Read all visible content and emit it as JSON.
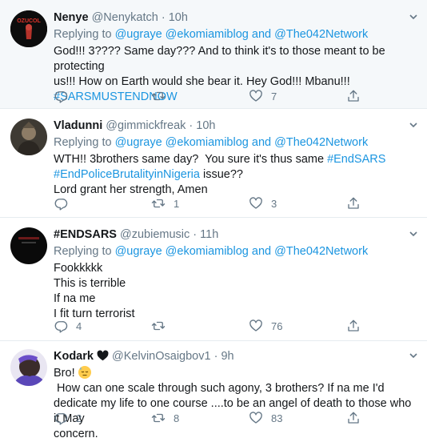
{
  "tweets": [
    {
      "display_name": "Nenye",
      "handle": "@Nenykatch",
      "dot": "·",
      "time": "10h",
      "replying_prefix": "Replying to",
      "replying_to": [
        "@ugraye",
        "@ekomiamiblog",
        "and",
        "@The042Network"
      ],
      "lines": [
        "God!!! 3???? Same day??? And to think it's to those meant to be protecting",
        "us!!! How on Earth would she bear it. Hey God!!! Mbanu!!!"
      ],
      "hashtag": "#SARSMUSTENDNOW",
      "avatar_text": "OZUCOL",
      "replies": "",
      "retweets": "",
      "likes": "7"
    },
    {
      "display_name": "Vladunni",
      "handle": "@gimmickfreak",
      "dot": "·",
      "time": "10h",
      "replying_prefix": "Replying to",
      "replying_to": [
        "@ugraye",
        "@ekomiamiblog",
        "and",
        "@The042Network"
      ],
      "line1_text": "WTH!! 3brothers same day?  You sure it's thus same ",
      "line1_link": "#EndSARS",
      "line2_link": "#EndPoliceBrutalityinNigeria",
      "line2_text": " issue??",
      "line3": "Lord grant her strength, Amen",
      "replies": "",
      "retweets": "1",
      "likes": "3"
    },
    {
      "display_name": "#ENDSARS",
      "handle": "@zubiemusic",
      "dot": "·",
      "time": "11h",
      "replying_prefix": "Replying to",
      "replying_to": [
        "@ugraye",
        "@ekomiamiblog",
        "and",
        "@The042Network"
      ],
      "lines": [
        "Fookkkkk",
        "This is terrible",
        "If na me",
        "I fit turn terrorist"
      ],
      "replies": "4",
      "retweets": "",
      "likes": "76"
    },
    {
      "display_name": "Kodark",
      "handle": "@KelvinOsaigbov1",
      "dot": "·",
      "time": "9h",
      "line1_a": "Bro! ",
      "line1_b": " How can one scale through such agony, 3 brothers? If na me I'd",
      "line2": "dedicate my life to one course ....to be an angel of death to those who it May",
      "line3": "concern.",
      "replies": "2",
      "retweets": "8",
      "likes": "83"
    }
  ],
  "colors": {
    "link": "#1b95e0",
    "muted": "#657786",
    "text": "#14171a",
    "highlight_bg": "#f5f8fa",
    "divider": "#e6ecf0"
  },
  "icons": {
    "reply": "reply-icon",
    "retweet": "retweet-icon",
    "like": "heart-icon",
    "share": "share-icon",
    "caret": "chevron-down-icon"
  }
}
